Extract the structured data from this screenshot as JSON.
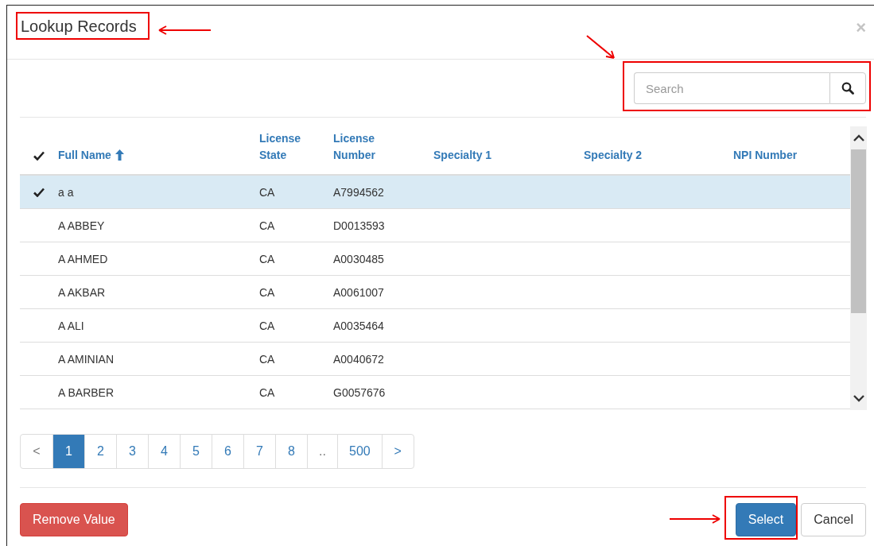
{
  "dialog": {
    "title": "Lookup Records",
    "close": "×"
  },
  "search": {
    "placeholder": "Search"
  },
  "table": {
    "columns": [
      {
        "label": "Full Name",
        "sorted": true
      },
      {
        "label": "License State",
        "sorted": false
      },
      {
        "label": "License Number",
        "sorted": false
      },
      {
        "label": "Specialty 1",
        "sorted": false
      },
      {
        "label": "Specialty 2",
        "sorted": false
      },
      {
        "label": "NPI Number",
        "sorted": false
      }
    ],
    "rows": [
      {
        "selected": true,
        "cells": [
          "a a",
          "CA",
          "A7994562"
        ]
      },
      {
        "selected": false,
        "cells": [
          "A ABBEY",
          "CA",
          "D0013593"
        ]
      },
      {
        "selected": false,
        "cells": [
          "A AHMED",
          "CA",
          "A0030485"
        ]
      },
      {
        "selected": false,
        "cells": [
          "A AKBAR",
          "CA",
          "A0061007"
        ]
      },
      {
        "selected": false,
        "cells": [
          "A ALI",
          "CA",
          "A0035464"
        ]
      },
      {
        "selected": false,
        "cells": [
          "A AMINIAN",
          "CA",
          "A0040672"
        ]
      },
      {
        "selected": false,
        "cells": [
          "A BARBER",
          "CA",
          "G0057676"
        ]
      }
    ]
  },
  "pagination": [
    {
      "label": "<",
      "selected": false
    },
    {
      "label": "1",
      "selected": true
    },
    {
      "label": "2",
      "selected": false
    },
    {
      "label": "3",
      "selected": false
    },
    {
      "label": "4",
      "selected": false
    },
    {
      "label": "5",
      "selected": false
    },
    {
      "label": "6",
      "selected": false
    },
    {
      "label": "7",
      "selected": false
    },
    {
      "label": "8",
      "selected": false
    },
    {
      "label": "..",
      "selected": false
    },
    {
      "label": "500",
      "selected": false
    },
    {
      "label": ">",
      "selected": false
    }
  ],
  "buttons": [
    {
      "label": "Remove Value",
      "kind": "danger"
    },
    {
      "label": "Select",
      "kind": "primary"
    },
    {
      "label": "Cancel",
      "kind": "default"
    }
  ]
}
